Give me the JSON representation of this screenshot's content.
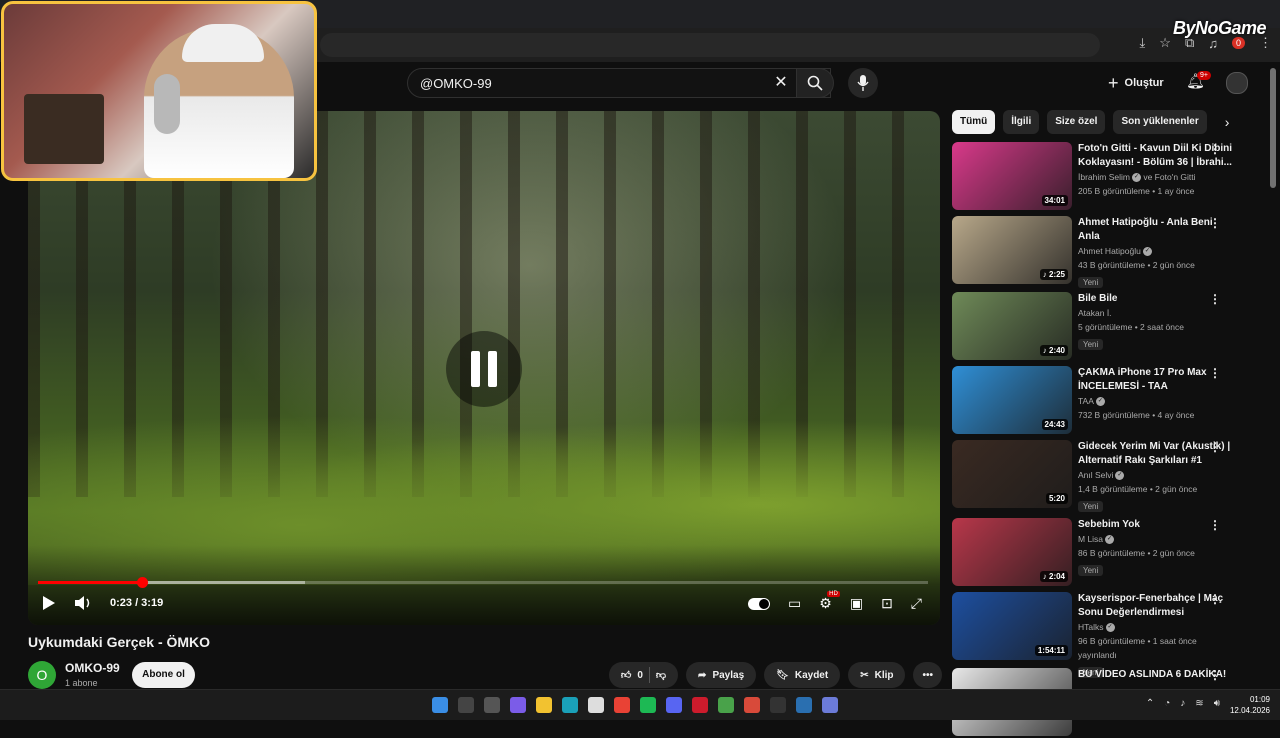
{
  "watermark": "ByNoGame",
  "browser": {
    "extension_badge": "0"
  },
  "header": {
    "search_value": "@OMKO-99",
    "create_label": "Oluştur",
    "notifications_badge": "9+"
  },
  "player": {
    "time": "0:23 / 3:19",
    "progress_fraction": 0.117,
    "buffered_fraction": 0.3
  },
  "video": {
    "title": "Uykumdaki Gerçek - ÖMKO",
    "channel_initial": "O",
    "channel_name": "OMKO-99",
    "subscribers": "1 abone",
    "subscribe_label": "Abone ol",
    "like_count": "0",
    "share_label": "Paylaş",
    "save_label": "Kaydet",
    "clip_label": "Klip"
  },
  "chips": [
    "Tümü",
    "İlgili",
    "Size özel",
    "Son yüklenenler"
  ],
  "recommendations": [
    {
      "title": "Foto'n Gitti - Kavun Diil Ki Dibini Koklayasın! - Bölüm 36 | İbrahi...",
      "channel": "İbrahim Selim",
      "channel_suffix": "ve Foto'n Gitti",
      "verified": true,
      "meta": "205 B görüntüleme • 1 ay önce",
      "duration": "34:01",
      "new": "",
      "thumb_color": "#d9398a"
    },
    {
      "title": "Ahmet Hatipoğlu - Anla Beni Anla",
      "channel": "Ahmet Hatipoğlu",
      "channel_suffix": "",
      "verified": true,
      "meta": "43 B görüntüleme • 2 gün önce",
      "duration": "♪ 2:25",
      "new": "Yeni",
      "thumb_color": "#b8a88a"
    },
    {
      "title": "Bile Bile",
      "channel": "Atakan İ.",
      "channel_suffix": "",
      "verified": false,
      "meta": "5 görüntüleme • 2 saat önce",
      "duration": "♪ 2:40",
      "new": "Yeni",
      "thumb_color": "#6f8a58"
    },
    {
      "title": "ÇAKMA iPhone 17 Pro Max İNCELEMESİ - TAA",
      "channel": "TAA",
      "channel_suffix": "",
      "verified": true,
      "meta": "732 B görüntüleme • 4 ay önce",
      "duration": "24:43",
      "new": "",
      "thumb_color": "#2f8fd6"
    },
    {
      "title": "Gidecek Yerim Mi Var (Akustik) | Alternatif Rakı Şarkıları #1",
      "channel": "Anıl Selvi",
      "channel_suffix": "",
      "verified": true,
      "meta": "1,4 B görüntüleme • 2 gün önce",
      "duration": "5:20",
      "new": "Yeni",
      "thumb_color": "#3a2a22"
    },
    {
      "title": "Sebebim Yok",
      "channel": "M Lisa",
      "channel_suffix": "",
      "verified": true,
      "meta": "86 B görüntüleme • 2 gün önce",
      "duration": "♪ 2:04",
      "new": "Yeni",
      "thumb_color": "#b8374a"
    },
    {
      "title": "Kayserispor-Fenerbahçe | Maç Sonu Değerlendirmesi",
      "channel": "HTalks",
      "channel_suffix": "",
      "verified": true,
      "meta": "96 B görüntüleme • 1 saat önce yayınlandı",
      "duration": "1:54:11",
      "new": "Yeni",
      "thumb_color": "#1d4fa0"
    },
    {
      "title": "BU VİDEO ASLINDA 6 DAKİKA!",
      "channel": "",
      "channel_suffix": "",
      "verified": false,
      "meta": "",
      "duration": "",
      "new": "",
      "thumb_color": "#e8e8e8"
    }
  ],
  "taskbar": {
    "time": "01:09",
    "date": "12.04.2026"
  }
}
